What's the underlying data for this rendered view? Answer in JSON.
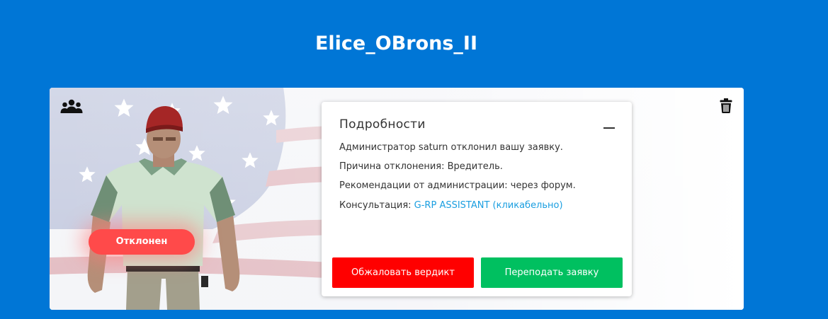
{
  "header": {
    "title": "Elice_OBrons_II"
  },
  "card": {
    "status_label": "Отклонен",
    "status_color": "#ff4a4a",
    "icons": {
      "group": "users-group-icon",
      "delete": "trash-icon"
    }
  },
  "details": {
    "title": "Подробности",
    "collapse_icon": "minus-icon",
    "line1": "Администратор saturn отклонил вашу заявку.",
    "line2": "Причина отклонения: Вредитель.",
    "line3": "Рекомендации от администрации: через форум.",
    "line4_prefix": "Консультация: ",
    "line4_link": "G-RP ASSISTANT (кликабельно)",
    "link_color": "#1a9ee0"
  },
  "actions": {
    "appeal_label": "Обжаловать вердикт",
    "appeal_color": "#ff0000",
    "resubmit_label": "Переподать заявку",
    "resubmit_color": "#00c060"
  },
  "colors": {
    "background": "#0076d6",
    "card": "#ffffff"
  }
}
